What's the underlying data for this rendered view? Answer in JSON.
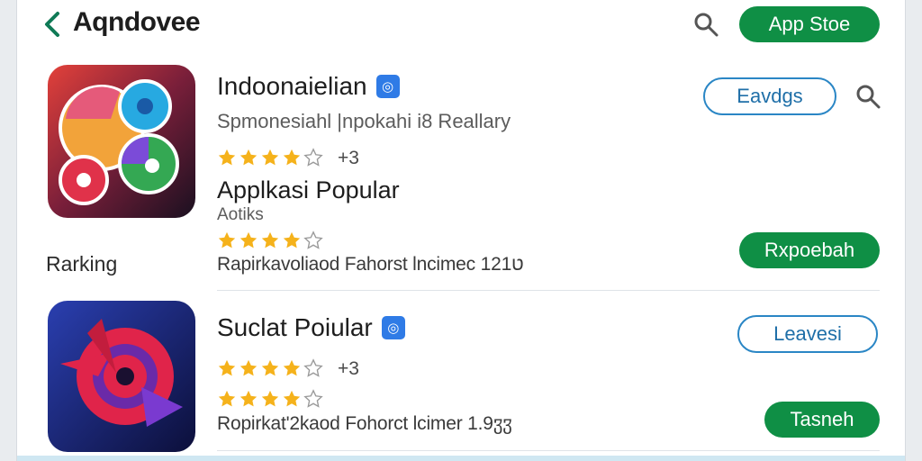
{
  "header": {
    "title": "Aqndovee",
    "store_button": "App Stoe"
  },
  "apps": [
    {
      "name": "Indoonaielian",
      "subtitle": "Spmonesiahl |npokahi i8 Reallary",
      "rating_count": "+3",
      "stars": 4,
      "action_outline": "Eavdgs",
      "section_heading": "Applkasi Popular",
      "section_sub": "Aotiks",
      "section_stars": 4,
      "meta": "Rapirkavoliaod  Fahorst  lncimec  12ט1",
      "action_solid": "Rxpoebah"
    },
    {
      "name": "Suclat Poiular",
      "rating_count": "+3",
      "stars": 4,
      "stars_row2": 4,
      "meta": "Ropirkat'2kaod  Fohorct  lcimer  1.9ჳჳ",
      "action_outline": "Leavesi",
      "action_solid": "Tasneh"
    }
  ],
  "ranking_label": "Rarking",
  "colors": {
    "accent_green": "#0f8f45",
    "outline_blue": "#2a86c5",
    "star_gold": "#f5b21b",
    "verified_blue": "#2f7be6"
  },
  "icons": [
    "back-chevron-icon",
    "search-icon",
    "verified-icon",
    "star-icon"
  ]
}
